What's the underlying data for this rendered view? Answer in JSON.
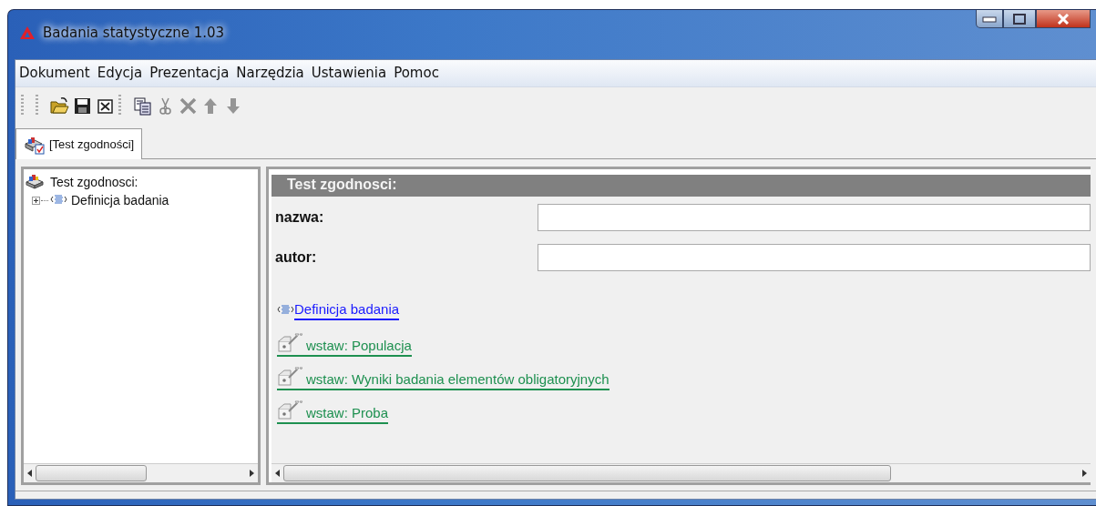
{
  "window": {
    "title": "Badania statystyczne 1.03"
  },
  "menu": [
    "Dokument",
    "Edycja",
    "Prezentacja",
    "Narzędzia",
    "Ustawienia",
    "Pomoc"
  ],
  "toolbar": [
    {
      "kind": "open",
      "disabled": false
    },
    {
      "kind": "save",
      "disabled": false
    },
    {
      "kind": "close",
      "disabled": false
    },
    {
      "kind": "sep"
    },
    {
      "kind": "copy",
      "disabled": false
    },
    {
      "kind": "cut",
      "disabled": true
    },
    {
      "kind": "delete",
      "disabled": true
    },
    {
      "kind": "up",
      "disabled": true
    },
    {
      "kind": "down",
      "disabled": true
    }
  ],
  "tabs": [
    {
      "label": "[Test zgodności]",
      "selected": true
    }
  ],
  "tree": {
    "label": "Test zgodnosci:",
    "children": [
      {
        "label": "Definicja badania",
        "expanded": false
      }
    ]
  },
  "panel": {
    "header": "Test zgodnosci:",
    "fields": [
      {
        "label": "nazwa:"
      },
      {
        "label": "autor:"
      }
    ],
    "links": [
      {
        "kind": "definition",
        "text": "Definicja badania"
      },
      {
        "kind": "insert",
        "text": "wstaw: Populacja"
      },
      {
        "kind": "insert",
        "text": "wstaw: Wyniki badania elementów obligatoryjnych"
      },
      {
        "kind": "insert",
        "text": "wstaw: Proba"
      }
    ]
  }
}
